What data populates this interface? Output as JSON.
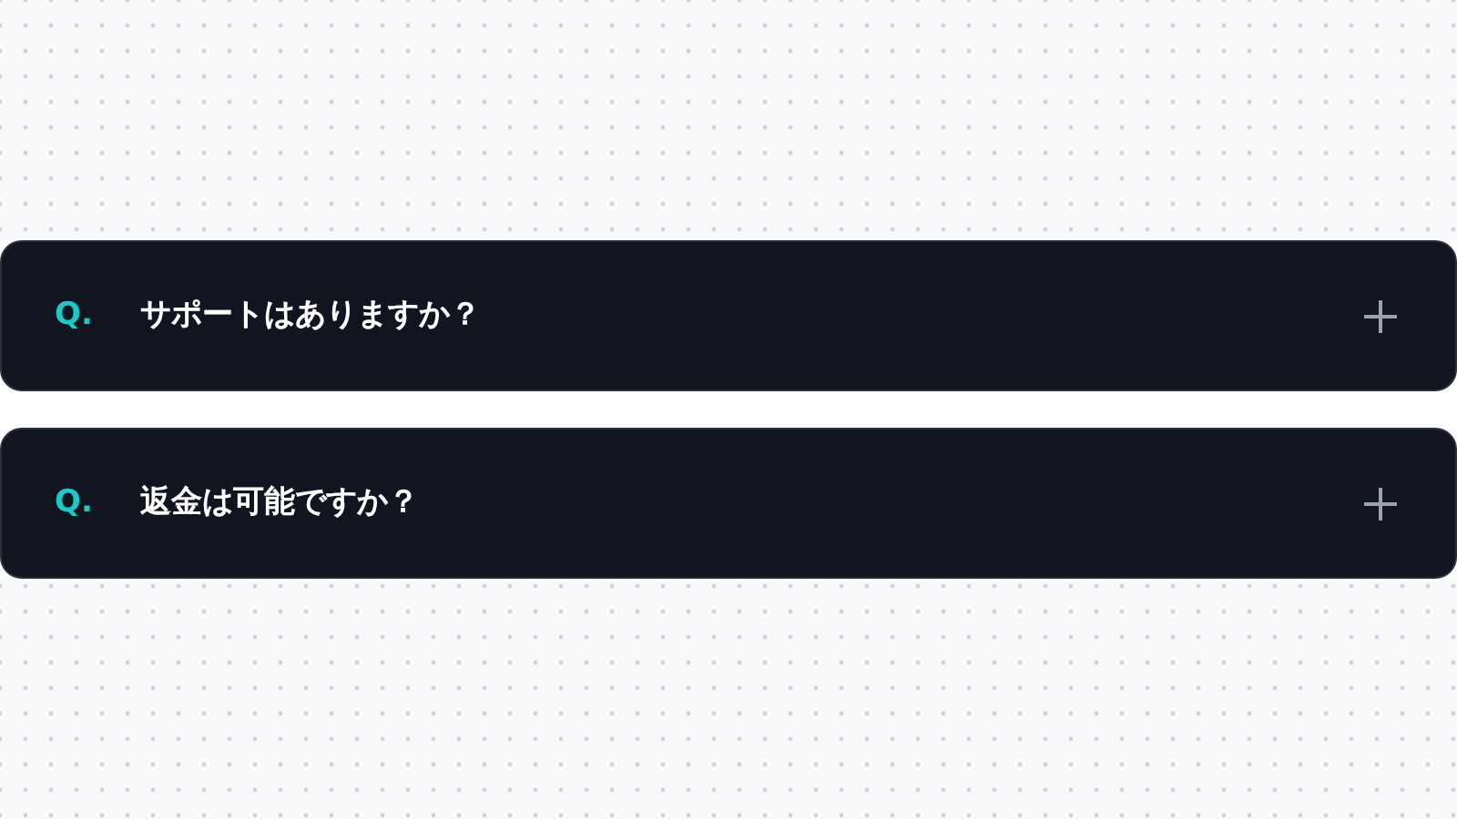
{
  "faq": [
    {
      "marker": "Q.",
      "question": "サポートはありますか？",
      "expanded": false
    },
    {
      "marker": "Q.",
      "question": "返金は可能ですか？",
      "expanded": false
    }
  ]
}
